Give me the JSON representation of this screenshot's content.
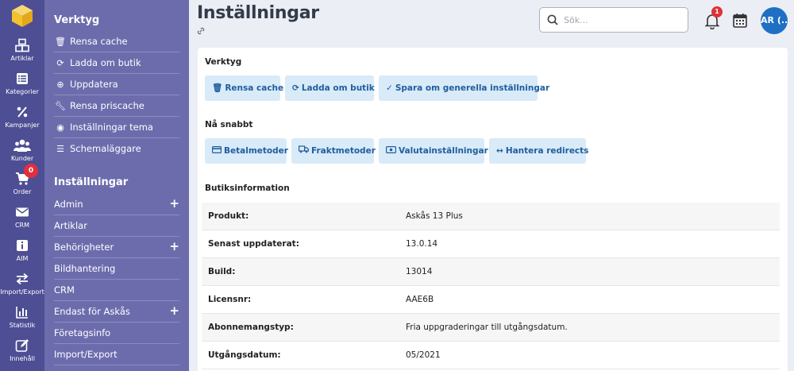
{
  "rail": {
    "items": [
      {
        "label": "Artiklar",
        "icon": "boxes-icon"
      },
      {
        "label": "Kategorier",
        "icon": "list-icon"
      },
      {
        "label": "Kampanjer",
        "icon": "percent-icon"
      },
      {
        "label": "Kunder",
        "icon": "users-icon"
      },
      {
        "label": "Order",
        "icon": "cart-icon",
        "badge": "0"
      },
      {
        "label": "CRM",
        "icon": "envelope-icon"
      },
      {
        "label": "AIM",
        "icon": "info-icon"
      },
      {
        "label": "Import/Export",
        "icon": "swap-icon"
      },
      {
        "label": "Statistik",
        "icon": "chart-icon"
      },
      {
        "label": "Innehåll",
        "icon": "edit-icon"
      }
    ]
  },
  "menu": {
    "tools_heading": "Verktyg",
    "tools": [
      {
        "label": "Rensa cache",
        "icon": "trash-icon"
      },
      {
        "label": "Ladda om butik",
        "icon": "refresh-icon"
      },
      {
        "label": "Uppdatera",
        "icon": "circle-arrow-icon"
      },
      {
        "label": "Rensa priscache",
        "icon": "wrench-icon"
      },
      {
        "label": "Inställningar tema",
        "icon": "eye-icon"
      },
      {
        "label": "Schemaläggare",
        "icon": "list-bullets-icon"
      }
    ],
    "settings_heading": "Inställningar",
    "settings": [
      {
        "label": "Admin",
        "expand": "+"
      },
      {
        "label": "Artiklar",
        "expand": ""
      },
      {
        "label": "Behörigheter",
        "expand": "+"
      },
      {
        "label": "Bildhantering",
        "expand": ""
      },
      {
        "label": "CRM",
        "expand": ""
      },
      {
        "label": "Endast för Askås",
        "expand": "+"
      },
      {
        "label": "Företagsinfo",
        "expand": ""
      },
      {
        "label": "Import/Export",
        "expand": ""
      }
    ]
  },
  "header": {
    "title": "Inställningar",
    "search_placeholder": "Sök...",
    "notifications_count": "1",
    "avatar_initials": "AR (..."
  },
  "tools_section": {
    "heading": "Verktyg",
    "buttons": [
      {
        "label": "Rensa cache",
        "icon": "trash-icon"
      },
      {
        "label": "Ladda om butik",
        "icon": "refresh-icon"
      },
      {
        "label": "Spara om generella inställningar",
        "icon": "check-icon"
      }
    ]
  },
  "quick_section": {
    "heading": "Nå snabbt",
    "buttons": [
      {
        "label": "Betalmetoder",
        "icon": "credit-card-icon"
      },
      {
        "label": "Fraktmetoder",
        "icon": "truck-icon"
      },
      {
        "label": "Valutainställningar",
        "icon": "money-icon"
      },
      {
        "label": "Hantera redirects",
        "icon": "arrows-horizontal-icon"
      }
    ]
  },
  "store_info": {
    "heading": "Butiksinformation",
    "rows": [
      {
        "key": "Produkt:",
        "value": "Askås 13 Plus"
      },
      {
        "key": "Senast uppdaterat:",
        "value": "13.0.14"
      },
      {
        "key": "Build:",
        "value": "13014"
      },
      {
        "key": "Licensnr:",
        "value": "AAE6B"
      },
      {
        "key": "Abonnemangstyp:",
        "value": "Fria uppgraderingar till utgångsdatum."
      },
      {
        "key": "Utgångsdatum:",
        "value": "05/2021"
      }
    ]
  },
  "colors": {
    "rail_bg": "#4e4e94",
    "menu_bg": "#6c6cad",
    "button_bg": "#d9eaf8",
    "button_text": "#1f5e9e",
    "badge": "#e0303a",
    "avatar_bg": "#1f6fc4"
  }
}
